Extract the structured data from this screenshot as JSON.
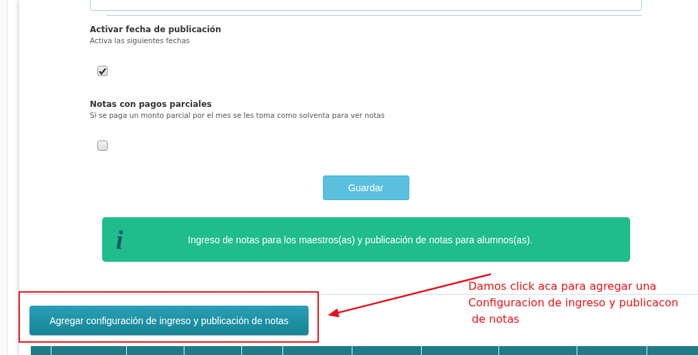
{
  "settings": [
    {
      "title": "Activar fecha de publicación",
      "description": "Activa las siguientes fechas",
      "checked": true
    },
    {
      "title": "Notas con pagos parciales",
      "description": "Si se paga un monto parcial por el mes se les toma como solventa para ver notas",
      "checked": false
    }
  ],
  "save_button": "Guardar",
  "info_banner": {
    "icon": "i",
    "text": "Ingreso de notas para los maestros(as) y publicación de notas para alumnos(as)."
  },
  "add_button": "Agregar configuración de ingreso y publicación de notas",
  "annotation": {
    "lines": [
      "Damos click aca para agregar una",
      "Configuracion de ingreso y publicacon",
      " de notas"
    ]
  }
}
